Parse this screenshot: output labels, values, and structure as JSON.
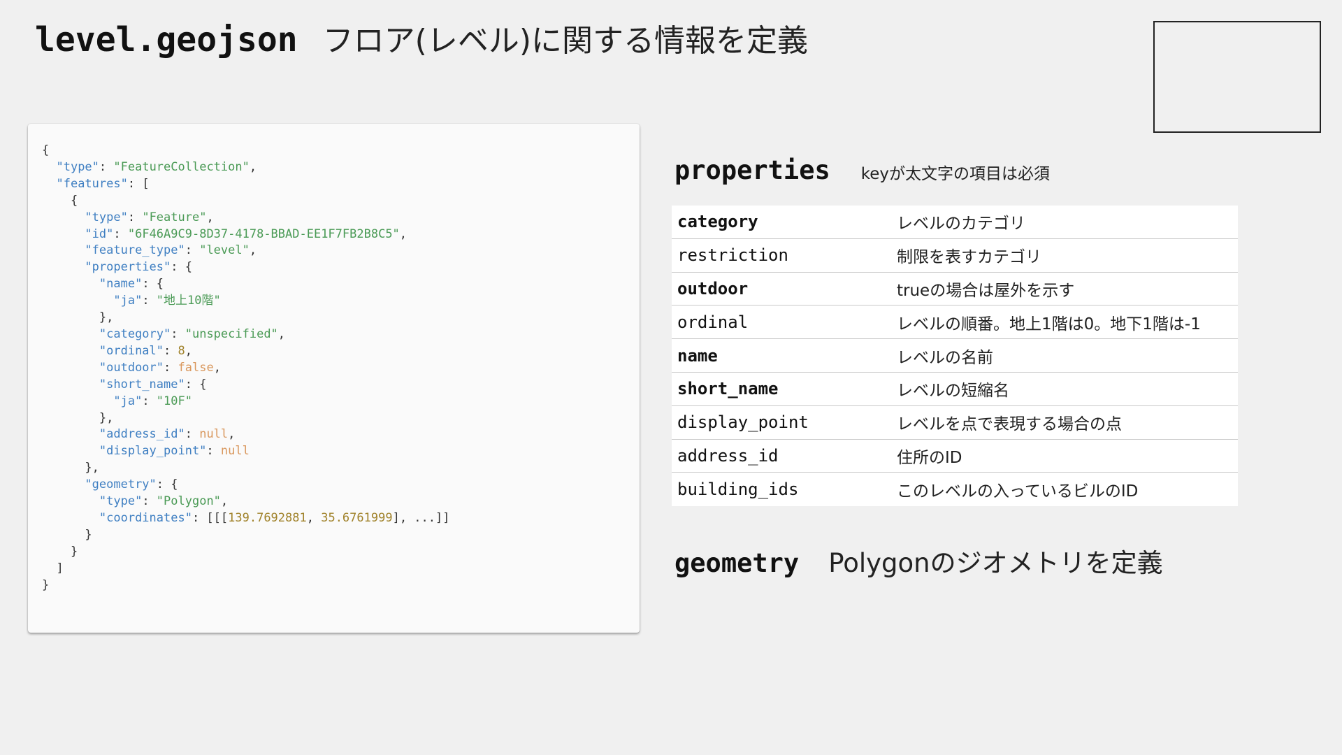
{
  "title": {
    "code": "level.geojson",
    "description": "フロア(レベル)に関する情報を定義"
  },
  "code_lines": [
    [
      {
        "t": "p",
        "v": "{"
      }
    ],
    [
      {
        "t": "p",
        "v": "  "
      },
      {
        "t": "k",
        "v": "\"type\""
      },
      {
        "t": "p",
        "v": ": "
      },
      {
        "t": "s",
        "v": "\"FeatureCollection\""
      },
      {
        "t": "p",
        "v": ","
      }
    ],
    [
      {
        "t": "p",
        "v": "  "
      },
      {
        "t": "k",
        "v": "\"features\""
      },
      {
        "t": "p",
        "v": ": ["
      }
    ],
    [
      {
        "t": "p",
        "v": "    {"
      }
    ],
    [
      {
        "t": "p",
        "v": "      "
      },
      {
        "t": "k",
        "v": "\"type\""
      },
      {
        "t": "p",
        "v": ": "
      },
      {
        "t": "s",
        "v": "\"Feature\""
      },
      {
        "t": "p",
        "v": ","
      }
    ],
    [
      {
        "t": "p",
        "v": "      "
      },
      {
        "t": "k",
        "v": "\"id\""
      },
      {
        "t": "p",
        "v": ": "
      },
      {
        "t": "s",
        "v": "\"6F46A9C9-8D37-4178-BBAD-EE1F7FB2B8C5\""
      },
      {
        "t": "p",
        "v": ","
      }
    ],
    [
      {
        "t": "p",
        "v": "      "
      },
      {
        "t": "k",
        "v": "\"feature_type\""
      },
      {
        "t": "p",
        "v": ": "
      },
      {
        "t": "s",
        "v": "\"level\""
      },
      {
        "t": "p",
        "v": ","
      }
    ],
    [
      {
        "t": "p",
        "v": "      "
      },
      {
        "t": "k",
        "v": "\"properties\""
      },
      {
        "t": "p",
        "v": ": {"
      }
    ],
    [
      {
        "t": "p",
        "v": "        "
      },
      {
        "t": "k",
        "v": "\"name\""
      },
      {
        "t": "p",
        "v": ": {"
      }
    ],
    [
      {
        "t": "p",
        "v": "          "
      },
      {
        "t": "k",
        "v": "\"ja\""
      },
      {
        "t": "p",
        "v": ": "
      },
      {
        "t": "s",
        "v": "\"地上10階\""
      }
    ],
    [
      {
        "t": "p",
        "v": "        },"
      }
    ],
    [
      {
        "t": "p",
        "v": "        "
      },
      {
        "t": "k",
        "v": "\"category\""
      },
      {
        "t": "p",
        "v": ": "
      },
      {
        "t": "s",
        "v": "\"unspecified\""
      },
      {
        "t": "p",
        "v": ","
      }
    ],
    [
      {
        "t": "p",
        "v": "        "
      },
      {
        "t": "k",
        "v": "\"ordinal\""
      },
      {
        "t": "p",
        "v": ": "
      },
      {
        "t": "n",
        "v": "8"
      },
      {
        "t": "p",
        "v": ","
      }
    ],
    [
      {
        "t": "p",
        "v": "        "
      },
      {
        "t": "k",
        "v": "\"outdoor\""
      },
      {
        "t": "p",
        "v": ": "
      },
      {
        "t": "b",
        "v": "false"
      },
      {
        "t": "p",
        "v": ","
      }
    ],
    [
      {
        "t": "p",
        "v": "        "
      },
      {
        "t": "k",
        "v": "\"short_name\""
      },
      {
        "t": "p",
        "v": ": {"
      }
    ],
    [
      {
        "t": "p",
        "v": "          "
      },
      {
        "t": "k",
        "v": "\"ja\""
      },
      {
        "t": "p",
        "v": ": "
      },
      {
        "t": "s",
        "v": "\"10F\""
      }
    ],
    [
      {
        "t": "p",
        "v": "        },"
      }
    ],
    [
      {
        "t": "p",
        "v": "        "
      },
      {
        "t": "k",
        "v": "\"address_id\""
      },
      {
        "t": "p",
        "v": ": "
      },
      {
        "t": "b",
        "v": "null"
      },
      {
        "t": "p",
        "v": ","
      }
    ],
    [
      {
        "t": "p",
        "v": "        "
      },
      {
        "t": "k",
        "v": "\"display_point\""
      },
      {
        "t": "p",
        "v": ": "
      },
      {
        "t": "b",
        "v": "null"
      }
    ],
    [
      {
        "t": "p",
        "v": "      },"
      }
    ],
    [
      {
        "t": "p",
        "v": "      "
      },
      {
        "t": "k",
        "v": "\"geometry\""
      },
      {
        "t": "p",
        "v": ": {"
      }
    ],
    [
      {
        "t": "p",
        "v": "        "
      },
      {
        "t": "k",
        "v": "\"type\""
      },
      {
        "t": "p",
        "v": ": "
      },
      {
        "t": "s",
        "v": "\"Polygon\""
      },
      {
        "t": "p",
        "v": ","
      }
    ],
    [
      {
        "t": "p",
        "v": "        "
      },
      {
        "t": "k",
        "v": "\"coordinates\""
      },
      {
        "t": "p",
        "v": ": [[["
      },
      {
        "t": "n",
        "v": "139.7692881"
      },
      {
        "t": "p",
        "v": ", "
      },
      {
        "t": "n",
        "v": "35.6761999"
      },
      {
        "t": "p",
        "v": "], ...]]"
      }
    ],
    [
      {
        "t": "p",
        "v": "      }"
      }
    ],
    [
      {
        "t": "p",
        "v": "    }"
      }
    ],
    [
      {
        "t": "p",
        "v": "  ]"
      }
    ],
    [
      {
        "t": "p",
        "v": "}"
      }
    ]
  ],
  "properties_section": {
    "heading": "properties",
    "note": "keyが太文字の項目は必須",
    "rows": [
      {
        "key": "category",
        "required": true,
        "desc": "レベルのカテゴリ"
      },
      {
        "key": "restriction",
        "required": false,
        "desc": "制限を表すカテゴリ"
      },
      {
        "key": "outdoor",
        "required": true,
        "desc": "trueの場合は屋外を示す"
      },
      {
        "key": "ordinal",
        "required": false,
        "desc": "レベルの順番。地上1階は0。地下1階は-1"
      },
      {
        "key": "name",
        "required": true,
        "desc": "レベルの名前"
      },
      {
        "key": "short_name",
        "required": true,
        "desc": "レベルの短縮名"
      },
      {
        "key": "display_point",
        "required": false,
        "desc": "レベルを点で表現する場合の点"
      },
      {
        "key": "address_id",
        "required": false,
        "desc": "住所のID"
      },
      {
        "key": "building_ids",
        "required": false,
        "desc": "このレベルの入っているビルのID"
      }
    ]
  },
  "geometry_section": {
    "heading": "geometry",
    "description": "Polygonのジオメトリを定義"
  },
  "colors": {
    "background": "#f0f0f0",
    "code_key": "#3f7fc2",
    "code_string": "#4a9a55",
    "code_number": "#a0822a",
    "code_literal": "#d9985e"
  }
}
